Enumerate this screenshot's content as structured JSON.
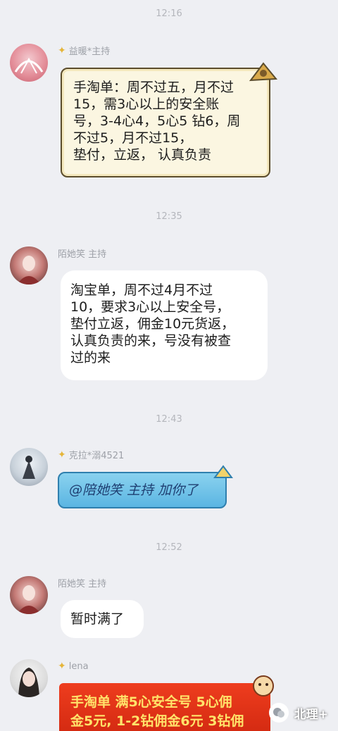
{
  "colors": {
    "background": "#eeeff3",
    "timestamp": "#b4b6bc",
    "badge_star": "#e5b53a",
    "red_bubble": "#e1341a",
    "red_bubble_text": "#ffe36a",
    "blue_bubble": "#6dc1e8"
  },
  "messages": [
    {
      "time": "12:16",
      "sender": "益暖*主持",
      "badge": "star-badge-icon",
      "style": "paper-scroll",
      "text": [
        "手淘单：周不过五，月不过",
        "15，需3心以上的安全账",
        "号，3-4心4，5心5 钻6，周",
        "不过5，月不过15，",
        "垫付，立返，  认真负责"
      ]
    },
    {
      "time": "12:35",
      "sender": "陌她笑  主持",
      "style": "white",
      "text": [
        "淘宝单，周不过4月不过",
        "10，要求3心以上安全号，",
        "垫付立返，佣金10元货返，",
        "认真负责的来，号没有被查",
        "过的来"
      ]
    },
    {
      "time": "12:43",
      "sender": "克拉*溺4521",
      "badge": "star-badge-icon",
      "style": "blue-bubble",
      "text": [
        "@陪她笑  主持  加你了"
      ]
    },
    {
      "time": "12:52",
      "sender": "陌她笑  主持",
      "style": "white",
      "text": [
        "暂时满了"
      ]
    },
    {
      "sender": "lena",
      "badge": "star-badge-icon",
      "style": "red-bubble",
      "text": [
        "手淘单 满5心安全号 5心佣",
        "金5元, 1-2钻佣金6元 3钻佣"
      ]
    }
  ],
  "watermark": {
    "icon": "wechat-channel-icon",
    "text": "北理+"
  }
}
